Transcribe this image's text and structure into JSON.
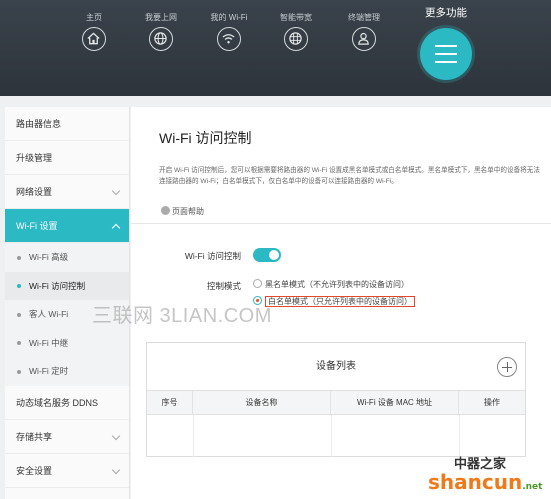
{
  "top_nav": {
    "items": [
      {
        "label": "主页",
        "icon": "home-icon"
      },
      {
        "label": "我要上网",
        "icon": "globe-icon"
      },
      {
        "label": "我的 Wi-Fi",
        "icon": "wifi-icon"
      },
      {
        "label": "智能带宽",
        "icon": "bandwidth-globe-icon"
      },
      {
        "label": "终端管理",
        "icon": "user-icon"
      }
    ],
    "more": {
      "label": "更多功能",
      "icon": "menu-icon"
    }
  },
  "sidebar": {
    "items": [
      {
        "label": "路由器信息"
      },
      {
        "label": "升级管理"
      },
      {
        "label": "网络设置"
      },
      {
        "label": "Wi-Fi 设置"
      },
      {
        "label": "动态域名服务 DDNS"
      },
      {
        "label": "存储共享"
      },
      {
        "label": "安全设置"
      }
    ],
    "wifi_sub": [
      {
        "label": "Wi-Fi 高级"
      },
      {
        "label": "Wi-Fi 访问控制"
      },
      {
        "label": "客人 Wi-Fi"
      },
      {
        "label": "Wi-Fi 中继"
      },
      {
        "label": "Wi-Fi 定时"
      }
    ]
  },
  "main": {
    "title": "Wi-Fi 访问控制",
    "description": "开启 Wi-Fi 访问控制后，您可以根据需要将路由器的 Wi-Fi 设置成黑名单模式或白名单模式。黑名单模式下，黑名单中的设备将无法连接路由器的 Wi-Fi；白名单模式下，仅白名单中的设备可以连接路由器的 Wi-Fi。",
    "help_label": "页面帮助",
    "toggle_label": "Wi-Fi 访问控制",
    "toggle_on": true,
    "mode_label": "控制模式",
    "mode_black": "黑名单模式（不允许列表中的设备访问）",
    "mode_white": "白名单模式（只允许列表中的设备访问）",
    "selected_mode": "white"
  },
  "watermark": "三联网 3LIAN.COM",
  "device_table": {
    "title": "设备列表",
    "columns": [
      "序号",
      "设备名称",
      "Wi-Fi 设备 MAC 地址",
      "操作"
    ]
  },
  "logo": {
    "cn": "中器之家",
    "en": "shancun",
    "net": ".net"
  },
  "colors": {
    "accent": "#2bb9c4",
    "nav_bg": "#2d343b",
    "highlight_box": "#e04a2a"
  }
}
